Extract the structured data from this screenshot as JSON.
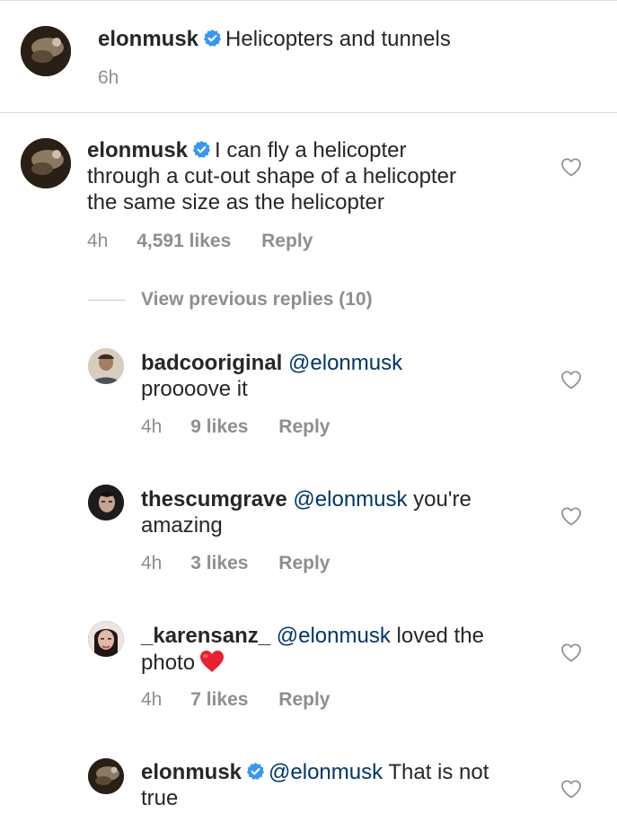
{
  "caption": {
    "username": "elonmusk",
    "text": "Helicopters and tunnels",
    "time": "6h"
  },
  "comments": [
    {
      "username": "elonmusk",
      "verified": true,
      "text_lines": [
        "I can fly a helicopter",
        "through a cut-out shape of a helicopter",
        "the same size as the helicopter"
      ],
      "time": "4h",
      "likes": "4,591 likes",
      "reply": "Reply"
    }
  ],
  "view_previous": "View previous replies (10)",
  "replies": [
    {
      "username": "badcooriginal",
      "mention": "@elonmusk",
      "text_line1": "",
      "text_line2": "proooove it",
      "time": "4h",
      "likes": "9 likes",
      "reply": "Reply"
    },
    {
      "username": "thescumgrave",
      "mention": "@elonmusk",
      "text_line1": " you're",
      "text_line2": "amazing",
      "time": "4h",
      "likes": "3 likes",
      "reply": "Reply"
    },
    {
      "username": "_karensanz_",
      "mention": "@elonmusk",
      "text_line1": " loved the",
      "text_line2": "photo",
      "emoji": "red-heart",
      "time": "4h",
      "likes": "7 likes",
      "reply": "Reply"
    },
    {
      "username": "elonmusk",
      "verified": true,
      "mention": "@elonmusk",
      "text_line1": " That is not",
      "text_line2": "true"
    }
  ],
  "icons": {
    "verified": "verified-badge-icon",
    "like": "heart-outline-icon",
    "emoji": "red-heart-emoji"
  },
  "colors": {
    "mention": "#003569",
    "verified": "#3897f0",
    "muted": "#8e8e8e",
    "text": "#262626"
  }
}
